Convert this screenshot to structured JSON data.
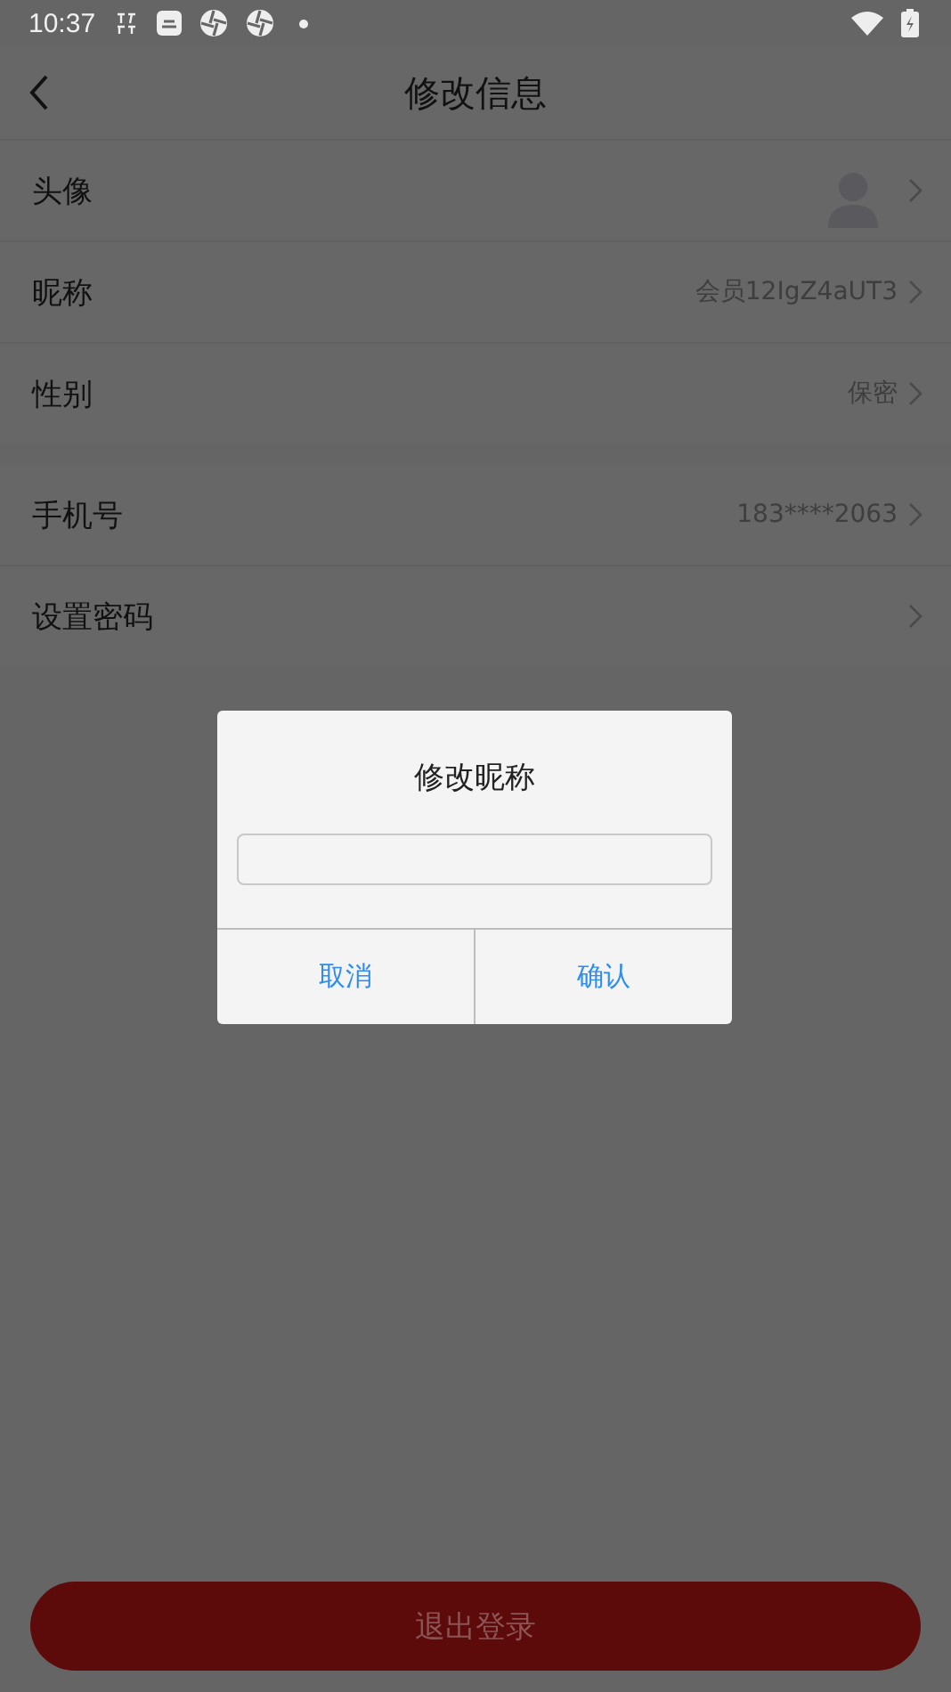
{
  "status_bar": {
    "time": "10:37"
  },
  "header": {
    "title": "修改信息"
  },
  "groups": [
    {
      "rows": [
        {
          "kind": "avatar",
          "label": "头像"
        },
        {
          "kind": "text",
          "label": "昵称",
          "value": "会员12IgZ4aUT3"
        },
        {
          "kind": "text",
          "label": "性别",
          "value": "保密"
        }
      ]
    },
    {
      "rows": [
        {
          "kind": "text",
          "label": "手机号",
          "value": "183****2063"
        },
        {
          "kind": "plain",
          "label": "设置密码"
        }
      ]
    }
  ],
  "logout_button": "退出登录",
  "dialog": {
    "title": "修改昵称",
    "buttons": [
      "取消",
      "确认"
    ]
  }
}
